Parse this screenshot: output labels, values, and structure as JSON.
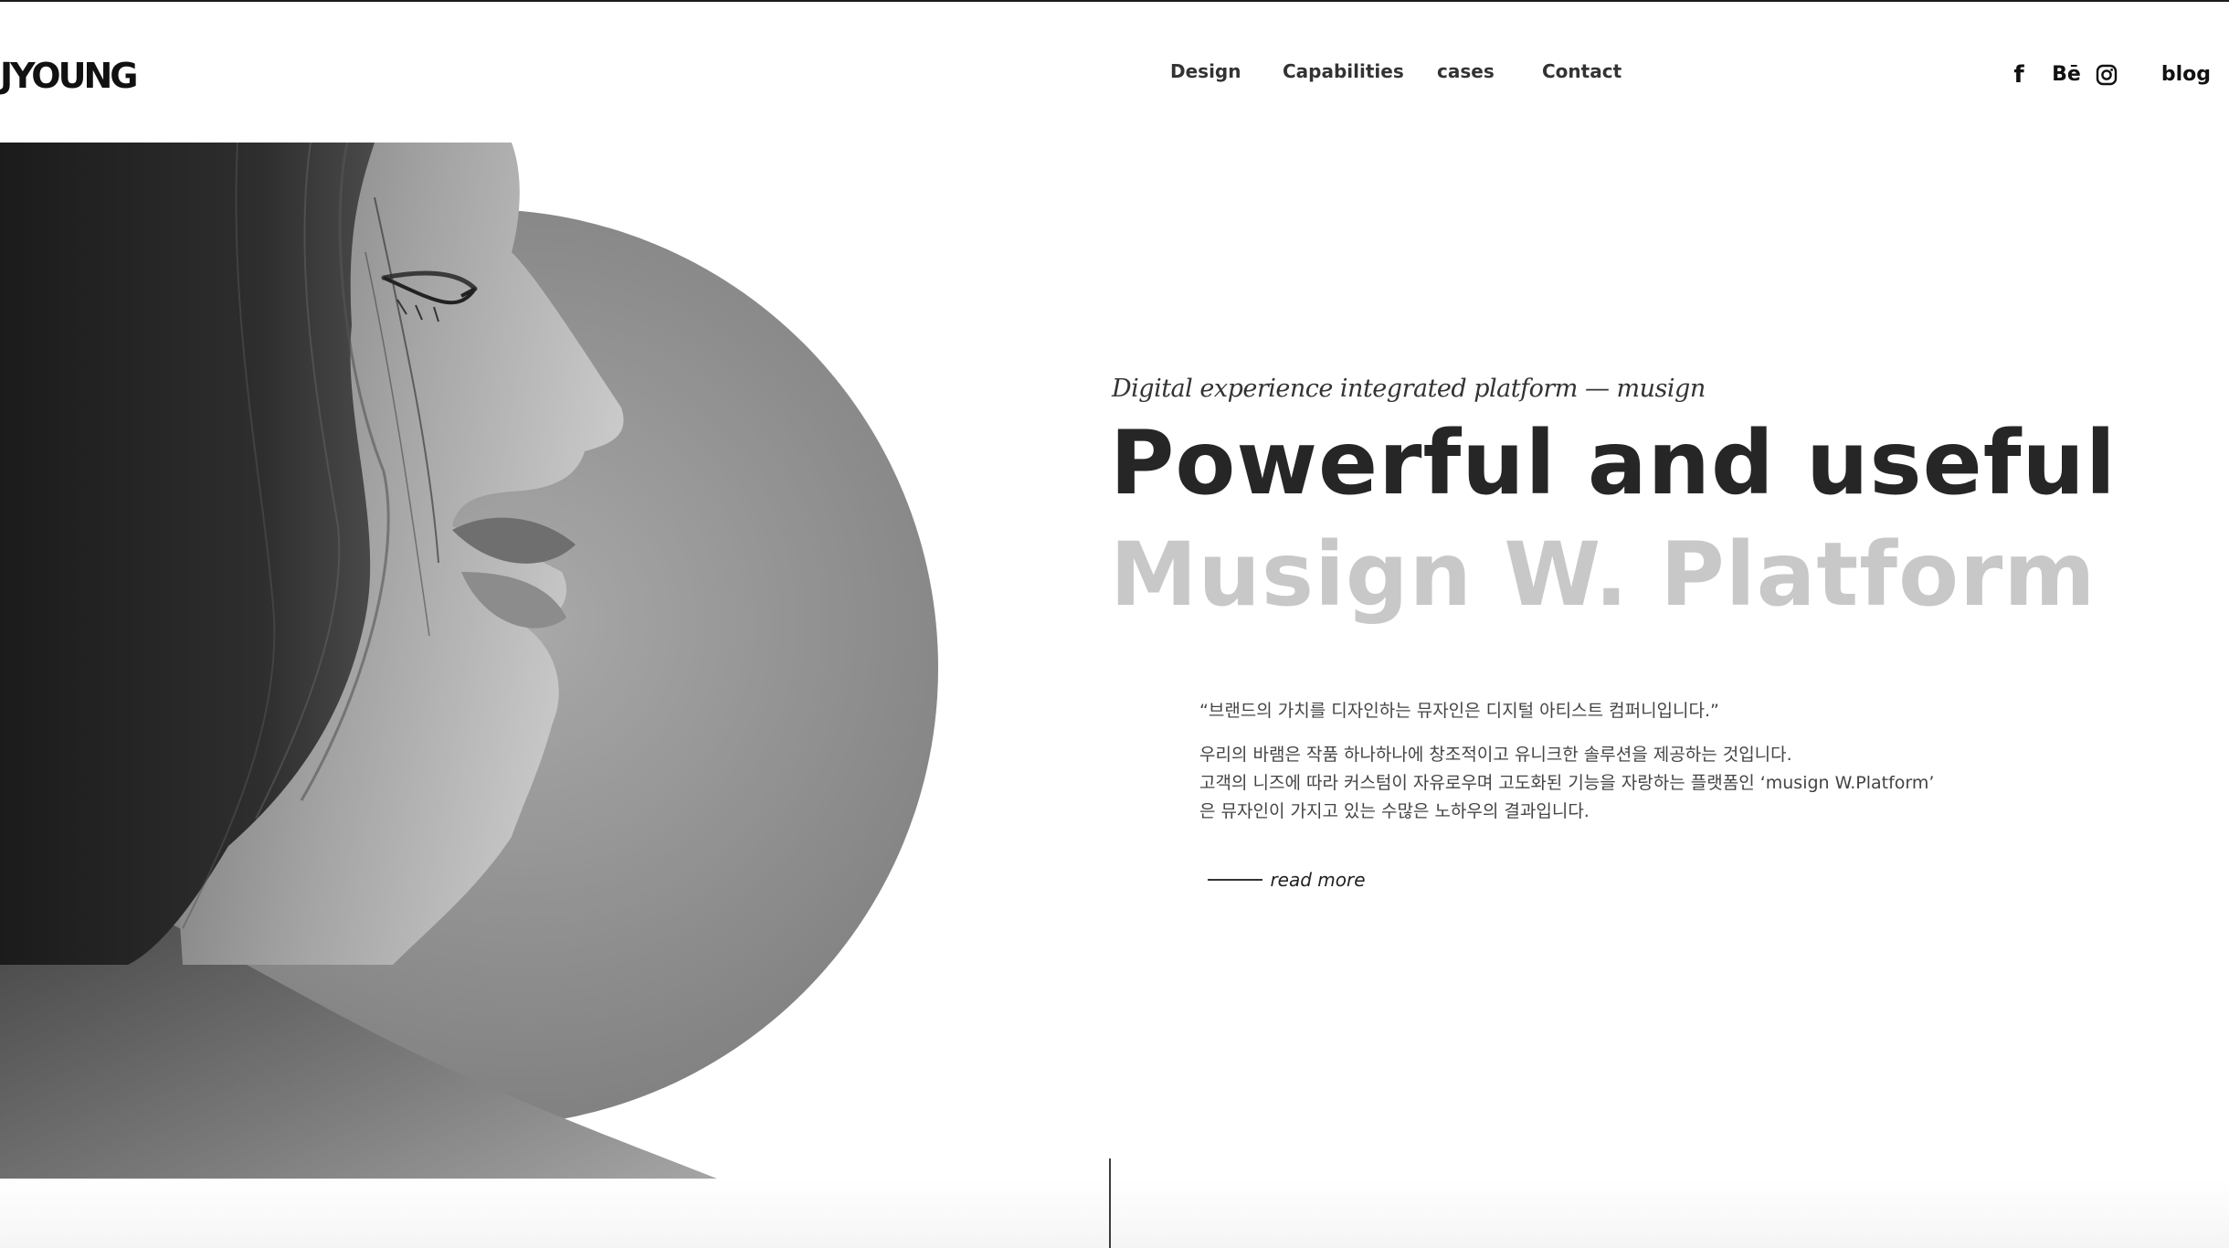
{
  "brand": {
    "logo_text": "JYOUNG"
  },
  "nav": {
    "items": [
      {
        "label": "Design"
      },
      {
        "label": "Capabilities"
      },
      {
        "label": "cases"
      },
      {
        "label": "Contact"
      }
    ]
  },
  "social": {
    "facebook_glyph": "f",
    "behance_glyph": "Bē",
    "instagram_icon": "instagram-icon",
    "blog_label": "blog"
  },
  "hero": {
    "eyebrow": "Digital experience integrated platform — musign",
    "headline_line1": "Powerful and useful",
    "headline_line2": "Musign W. Platform",
    "quote": "“브랜드의 가치를 디자인하는 뮤자인은 디지털 아티스트 컴퍼니입니다.”",
    "body_lines": [
      "우리의 바램은 작품 하나하나에 창조적이고 유니크한 솔루션을 제공하는 것입니다.",
      "고객의 니즈에 따라 커스텀이 자유로우며 고도화된 기능을 자랑하는 플랫폼인 ‘musign W.Platform’",
      "은 뮤자인이 가지고 있는 수많은 노하우의 결과입니다."
    ],
    "read_more_label": "read more"
  },
  "colors": {
    "headline_dark": "#262626",
    "headline_light": "#c8c8c8",
    "circle_gray": "#8e8e8e",
    "text_gray": "#444444"
  }
}
